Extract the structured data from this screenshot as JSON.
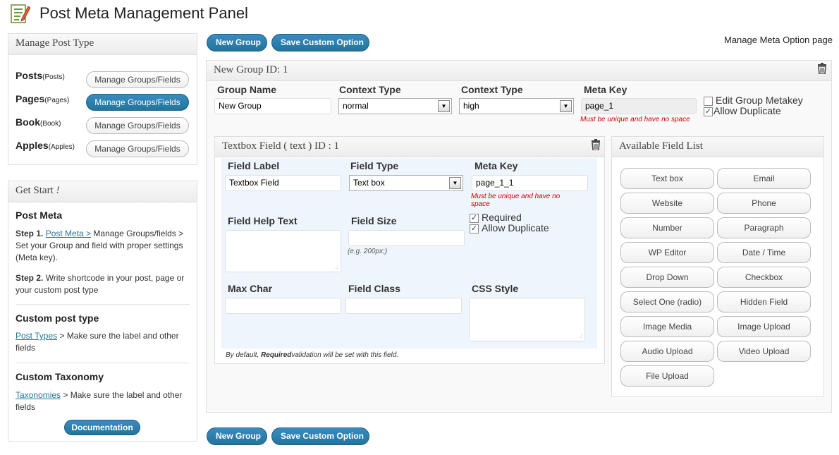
{
  "header": {
    "title": "Post Meta Management Panel",
    "right_link": "Manage Meta Option page"
  },
  "toolbar": {
    "new_group": "New Group",
    "save_custom_option": "Save Custom Option"
  },
  "manage_post_type": {
    "title": "Manage Post Type",
    "items": [
      {
        "label": "Posts",
        "sub": "(Posts)",
        "button": "Manage Groups/Fields",
        "active": false
      },
      {
        "label": "Pages",
        "sub": "(Pages)",
        "button": "Manage Groups/Fields",
        "active": true
      },
      {
        "label": "Book",
        "sub": "(Book)",
        "button": "Manage Groups/Fields",
        "active": false
      },
      {
        "label": "Apples",
        "sub": "(Apples)",
        "button": "Manage Groups/Fields",
        "active": false
      }
    ]
  },
  "get_start": {
    "title": "Get Start",
    "title_mark": "!",
    "post_meta_heading": "Post Meta",
    "step1_label": "Step 1.",
    "step1_link": "Post Meta >",
    "step1_text": " Manage Groups/fields > Set your Group and field with proper settings (Meta key).",
    "step2_label": "Step 2.",
    "step2_text": " Write shortcode in your post, page or your custom post type",
    "custom_post_type_heading": "Custom post type",
    "cpt_link": "Post Types",
    "cpt_text": " > Make sure the label and other fields",
    "custom_taxonomy_heading": "Custom Taxonomy",
    "tax_link": "Taxonomies",
    "tax_text": " > Make sure the label and other fields",
    "documentation_button": "Documentation"
  },
  "group": {
    "title": "New Group ID: 1",
    "group_name_label": "Group Name",
    "group_name_value": "New Group",
    "context_type_label": "Context Type",
    "context_type_value": "normal",
    "context_type2_label": "Context Type",
    "context_type2_value": "high",
    "meta_key_label": "Meta Key",
    "meta_key_value": "page_1",
    "meta_key_warning": "Must be unique and have no space",
    "edit_metakey_label": "Edit Group Metakey",
    "edit_metakey_checked": false,
    "allow_duplicate_label": "Allow Duplicate",
    "allow_duplicate_checked": true
  },
  "field": {
    "title": "Textbox Field ( text ) ID : 1",
    "field_label_label": "Field Label",
    "field_label_value": "Textbox Field",
    "field_type_label": "Field Type",
    "field_type_value": "Text box",
    "meta_key_label": "Meta Key",
    "meta_key_value": "page_1_1",
    "meta_key_warning": "Must be unique and have no space",
    "help_text_label": "Field Help Text",
    "field_size_label": "Field Size",
    "field_size_hint": "(e.g. 200px;)",
    "required_label": "Required",
    "required_checked": true,
    "allow_duplicate_label": "Allow Duplicate",
    "allow_duplicate_checked": true,
    "max_char_label": "Max Char",
    "field_class_label": "Field Class",
    "css_style_label": "CSS Style",
    "footer_prefix": "By default, ",
    "footer_bold": "Required",
    "footer_suffix": "validation will be set with this field."
  },
  "available_fields": {
    "title": "Available Field List",
    "items": [
      "Text box",
      "Email",
      "Website",
      "Phone",
      "Number",
      "Paragraph",
      "WP Editor",
      "Date / Time",
      "Drop Down",
      "Checkbox",
      "Select One (radio)",
      "Hidden Field",
      "Image Media",
      "Image Upload",
      "Audio Upload",
      "Video Upload",
      "File Upload"
    ]
  },
  "icons": {
    "app": "edit-document-icon",
    "trash": "trash-icon",
    "dropdown": "dropdown-arrow-icon"
  },
  "colors": {
    "primary_button": "#21759b",
    "warning": "#cc0000",
    "panel_bg": "#f9f9f9",
    "field_bg": "#eef5fc"
  }
}
